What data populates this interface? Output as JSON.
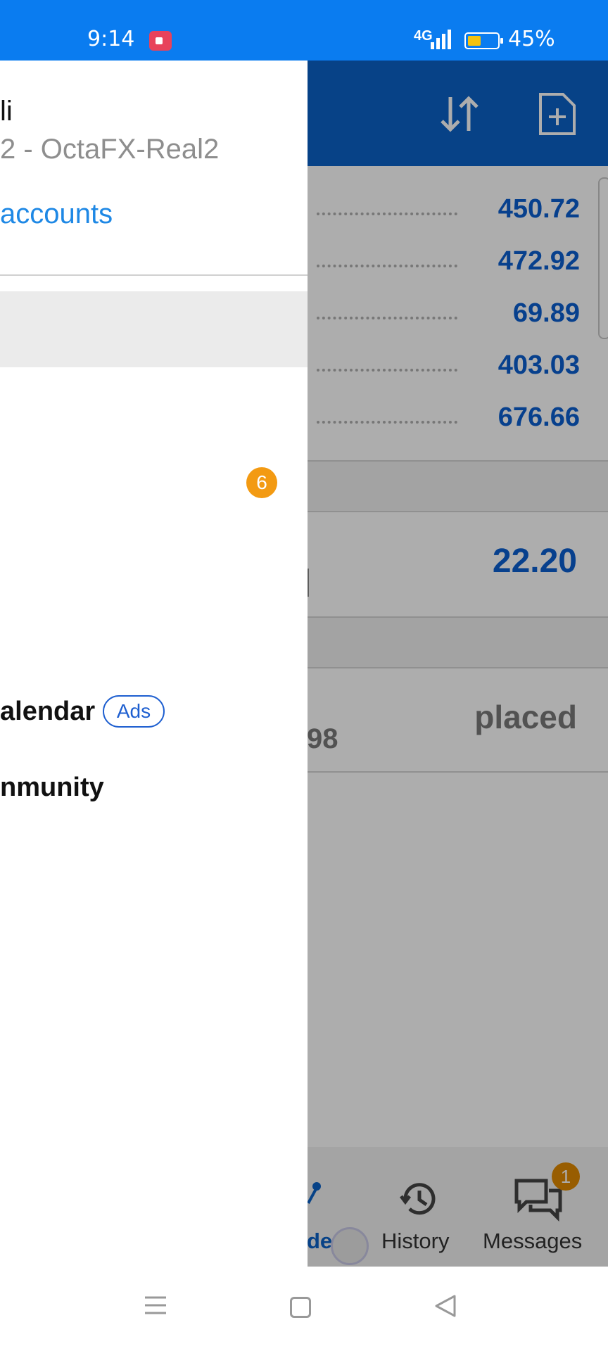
{
  "status_bar": {
    "time": "9:14",
    "network": "4G",
    "battery_percent": "45%",
    "battery_level": 0.45,
    "icons": [
      "screen-record-icon",
      "signal-icon",
      "battery-icon"
    ]
  },
  "app_bar": {
    "icons": [
      "sort-icon",
      "new-order-document-icon"
    ]
  },
  "background": {
    "values": [
      "450.72",
      "472.92",
      "69.89",
      "403.03",
      "676.66"
    ],
    "section_value": "22.20",
    "orders_status": "placed",
    "partial_number": "98"
  },
  "bottom_nav": {
    "trade_partial": "de",
    "history": "History",
    "messages": "Messages",
    "messages_badge": "1"
  },
  "drawer": {
    "account_name": "li",
    "server": "2 - OctaFX-Real2",
    "manage_accounts": "accounts",
    "badge_count": "6",
    "calendar": "alendar",
    "ads_label": "Ads",
    "community": "nmunity"
  },
  "colors": {
    "status_bar": "#0a7cf0",
    "app_bar": "#0b62c8",
    "value_text": "#0b5fd0",
    "badge_orange": "#f39a12",
    "link_blue": "#1e88e5"
  }
}
